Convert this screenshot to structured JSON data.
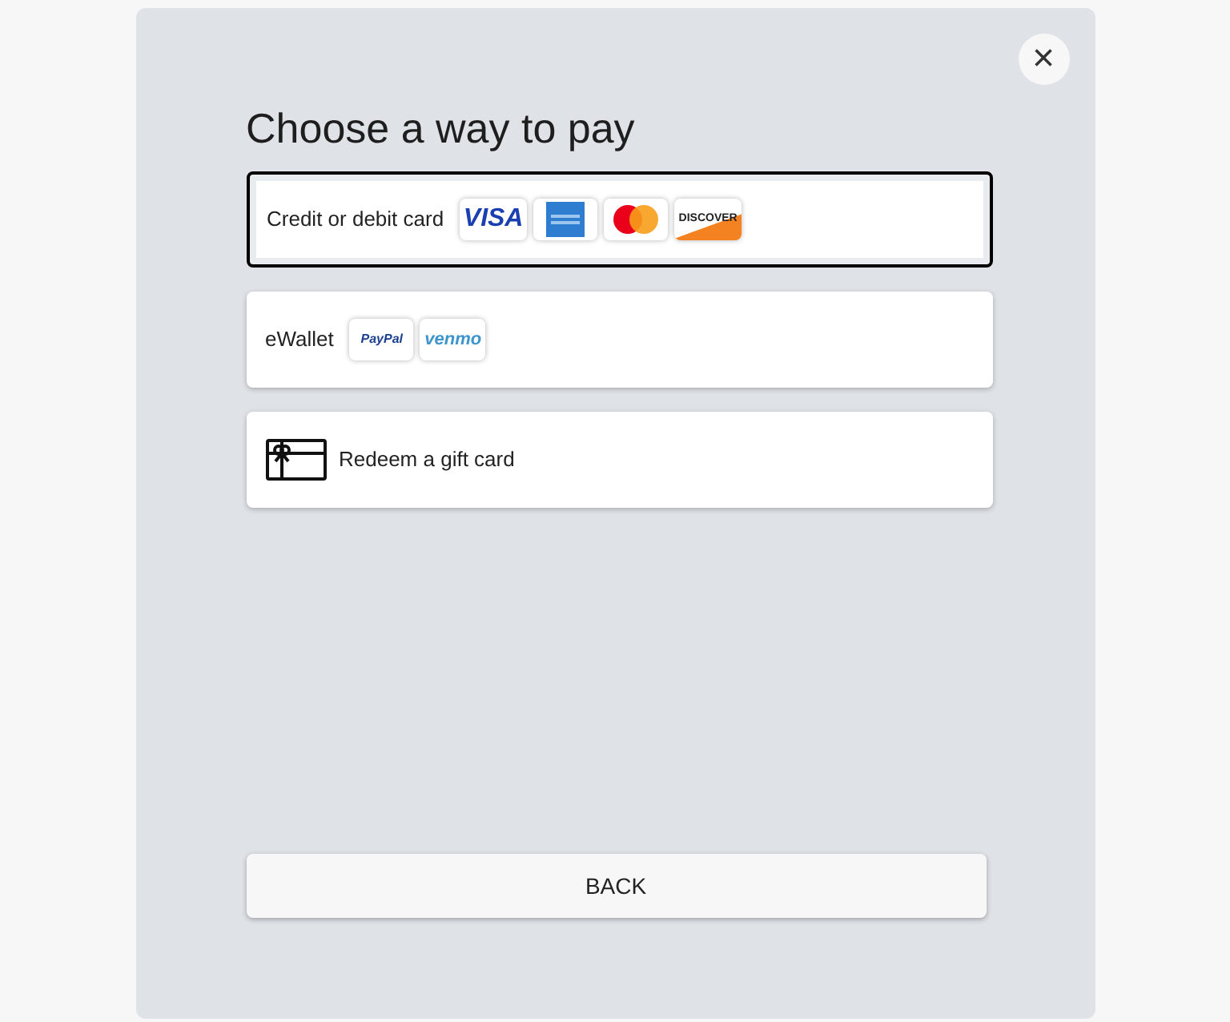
{
  "dialog": {
    "title": "Choose a way to pay",
    "close_label": "×"
  },
  "options": [
    {
      "kind": "cards",
      "label": "Credit or debit card",
      "selected": true,
      "logos": [
        {
          "kind": "visa",
          "text": "VISA"
        },
        {
          "kind": "amex"
        },
        {
          "kind": "mastercard"
        },
        {
          "kind": "discover",
          "text": "DISCOVER"
        }
      ]
    },
    {
      "kind": "wallet",
      "label": "eWallet",
      "selected": false,
      "logos": [
        {
          "kind": "paypal",
          "text": "PayPal"
        },
        {
          "kind": "venmo",
          "text": "venmo"
        }
      ]
    },
    {
      "kind": "gift",
      "label": "Redeem a gift card",
      "selected": false
    }
  ],
  "back_button": "BACK"
}
